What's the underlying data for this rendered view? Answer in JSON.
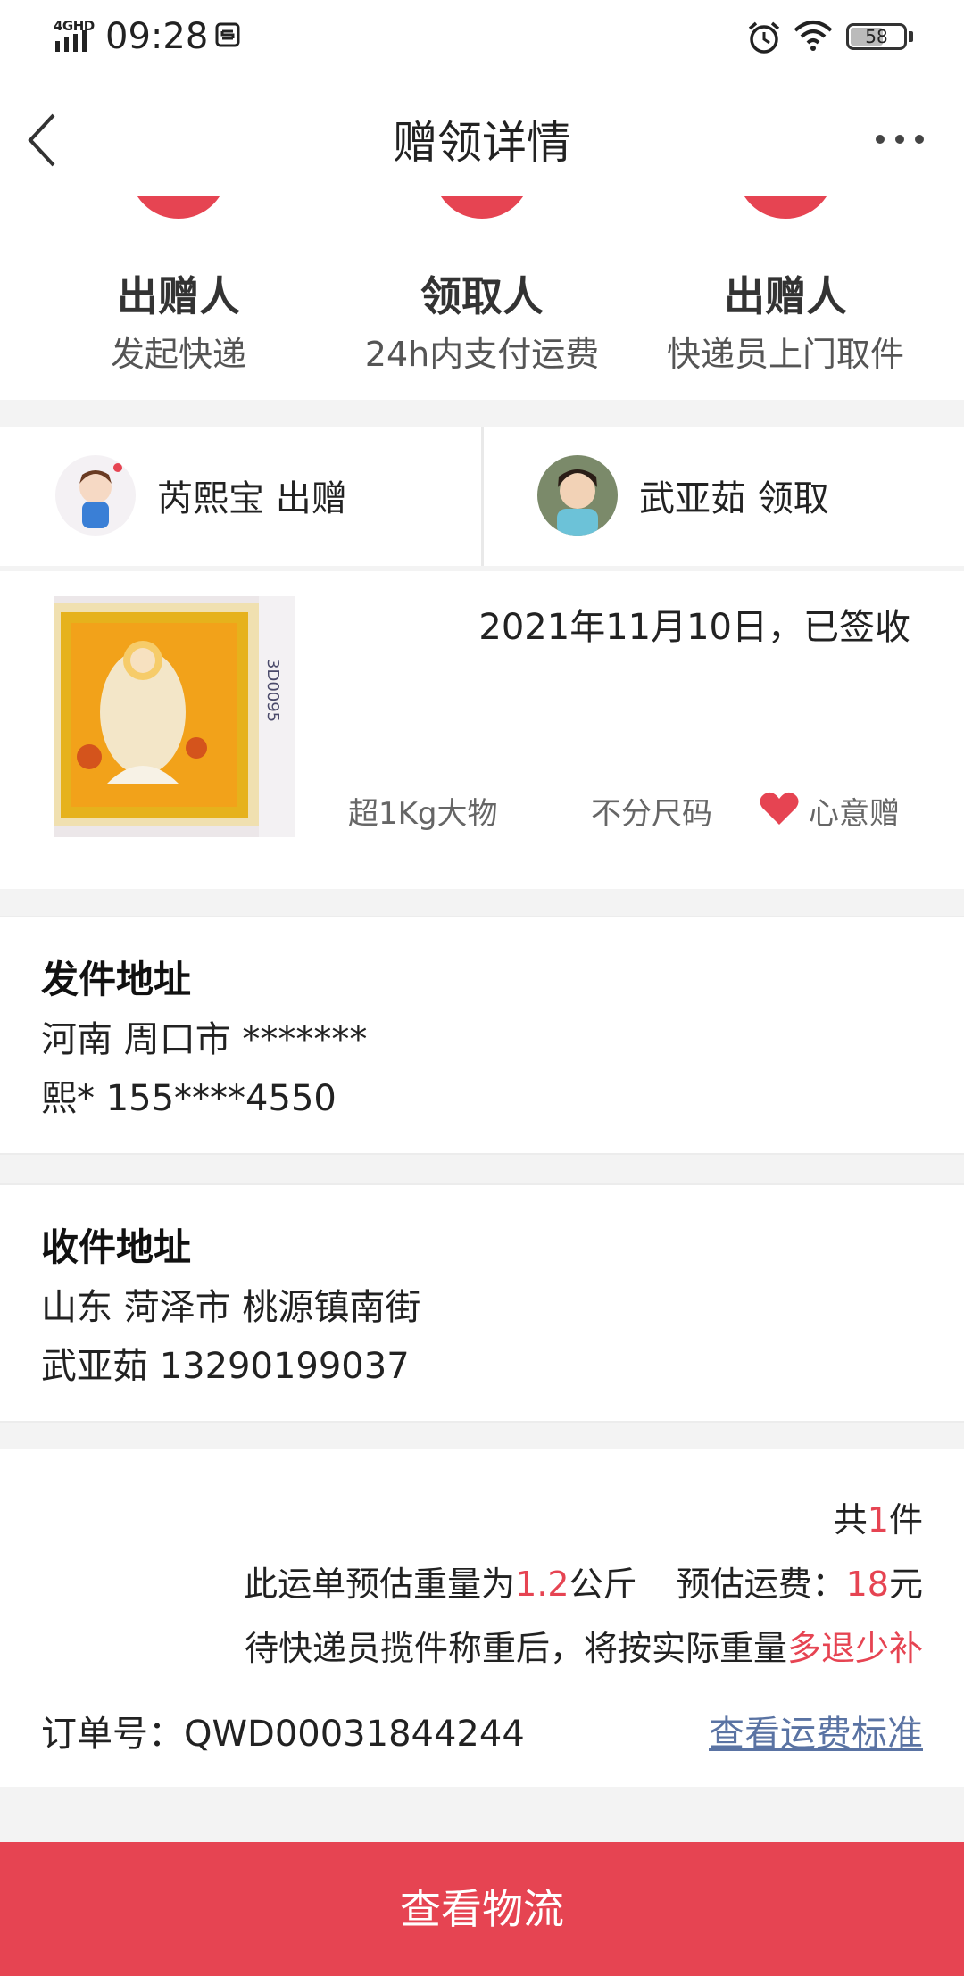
{
  "status_bar": {
    "network": "4GHD",
    "time": "09:28",
    "battery": "58"
  },
  "nav": {
    "title": "赠领详情"
  },
  "steps": [
    {
      "title": "出赠人",
      "subtitle": "发起快递"
    },
    {
      "title": "领取人",
      "subtitle": "24h内支付运费"
    },
    {
      "title": "出赠人",
      "subtitle": "快递员上门取件"
    }
  ],
  "giver": {
    "label": "芮熙宝 出赠"
  },
  "receiver": {
    "label": "武亚茹 领取"
  },
  "item": {
    "date_status": "2021年11月10日，已签收",
    "tags": [
      "超1Kg大物",
      "不分尺码",
      "心意赠"
    ]
  },
  "send_address": {
    "heading": "发件地址",
    "line1": "河南 周口市 *******",
    "line2": "熙* 155****4550"
  },
  "receive_address": {
    "heading": "收件地址",
    "line1": "山东 菏泽市 桃源镇南街",
    "line2": "武亚茹 13290199037"
  },
  "fee": {
    "count_prefix": "共",
    "count": "1",
    "count_suffix": "件",
    "weight_prefix": "此运单预估重量为",
    "weight": "1.2",
    "weight_unit": "公斤",
    "fee_prefix": "预估运费：",
    "fee": "18",
    "fee_unit": "元",
    "note_prefix": "待快递员揽件称重后，将按实际重量",
    "note_highlight": "多退少补",
    "order_label": "订单号：",
    "order_number": "QWD00031844244",
    "standard_link": "查看运费标准"
  },
  "bottom_button": "查看物流",
  "colors": {
    "accent": "#e64452",
    "link": "#5a73a3"
  },
  "icons": [
    "back-arrow-icon",
    "more-icon",
    "heart-icon",
    "alarm-icon",
    "wifi-icon",
    "battery-icon",
    "signal-icon"
  ]
}
